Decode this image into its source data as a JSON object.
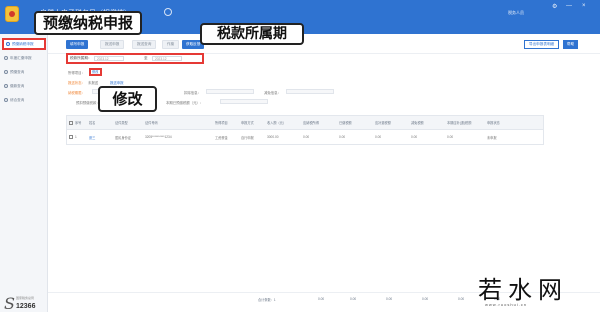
{
  "topbar": {
    "app_title": "自然人电子税务局（扣缴端）",
    "user_text": "税务人员",
    "ctrl_settings": "⚙",
    "ctrl_minimize": "—",
    "ctrl_close": "×"
  },
  "sidebar": {
    "items": [
      {
        "label": "预缴纳税申报",
        "active": true
      },
      {
        "label": "年度汇缴申报",
        "active": false
      },
      {
        "label": "预缴查询",
        "active": false
      },
      {
        "label": "缴款查询",
        "active": false
      },
      {
        "label": "综合查询",
        "active": false
      }
    ],
    "brand_small": "国家税务总局",
    "brand_number": "12366"
  },
  "tabs": [
    "填写申报",
    "报送申报",
    "报送查询",
    "作废",
    "获取反馈"
  ],
  "actions": {
    "export": "导出申报表明细",
    "help": "帮助"
  },
  "period": {
    "label": "税款所属期：",
    "start": "2023.12",
    "separator": "至",
    "end": "2023.12"
  },
  "info": {
    "income_type_label": "所得项目：",
    "income_type_value": "修改",
    "status_label": "报送状态：",
    "status_value": "未报送",
    "declare_link": "报送申报",
    "tax_period_label": "纳税期限：",
    "deduction_label": "扣除信息：",
    "relief_label": "减免信息：",
    "prepaid_label": "预扣预缴税款：",
    "prepaid_field_label": "本期已预缴税额（元）："
  },
  "table": {
    "headers": [
      "序号",
      "姓名",
      "证件类型",
      "证件号码",
      "所得项目",
      "申报方式",
      "收入额（元）",
      "应纳税所得",
      "已缴税额",
      "应补退税额",
      "减免税额",
      "本期应补(退)税额",
      "申报状态"
    ],
    "rows": [
      [
        "1",
        "张三",
        "居民身份证",
        "3205**********1234",
        "工资薪金",
        "自行申报",
        "3000.00",
        "0.00",
        "0.00",
        "0.00",
        "0.00",
        "0.00",
        "未申报"
      ]
    ]
  },
  "footer": {
    "total_label": "合计条数：1",
    "totals": [
      "0.00",
      "0.00",
      "0.00",
      "0.00",
      "0.00",
      "0.00"
    ]
  },
  "callouts": {
    "step1": "预缴纳税申报",
    "step2": "税款所属期",
    "step3": "修改"
  },
  "watermark": {
    "text": "若水网",
    "url": "www.ruoshui.cn"
  },
  "colors": {
    "brand_blue": "#2f73d1",
    "highlight_red": "#e53935",
    "orange": "#f0883a"
  }
}
